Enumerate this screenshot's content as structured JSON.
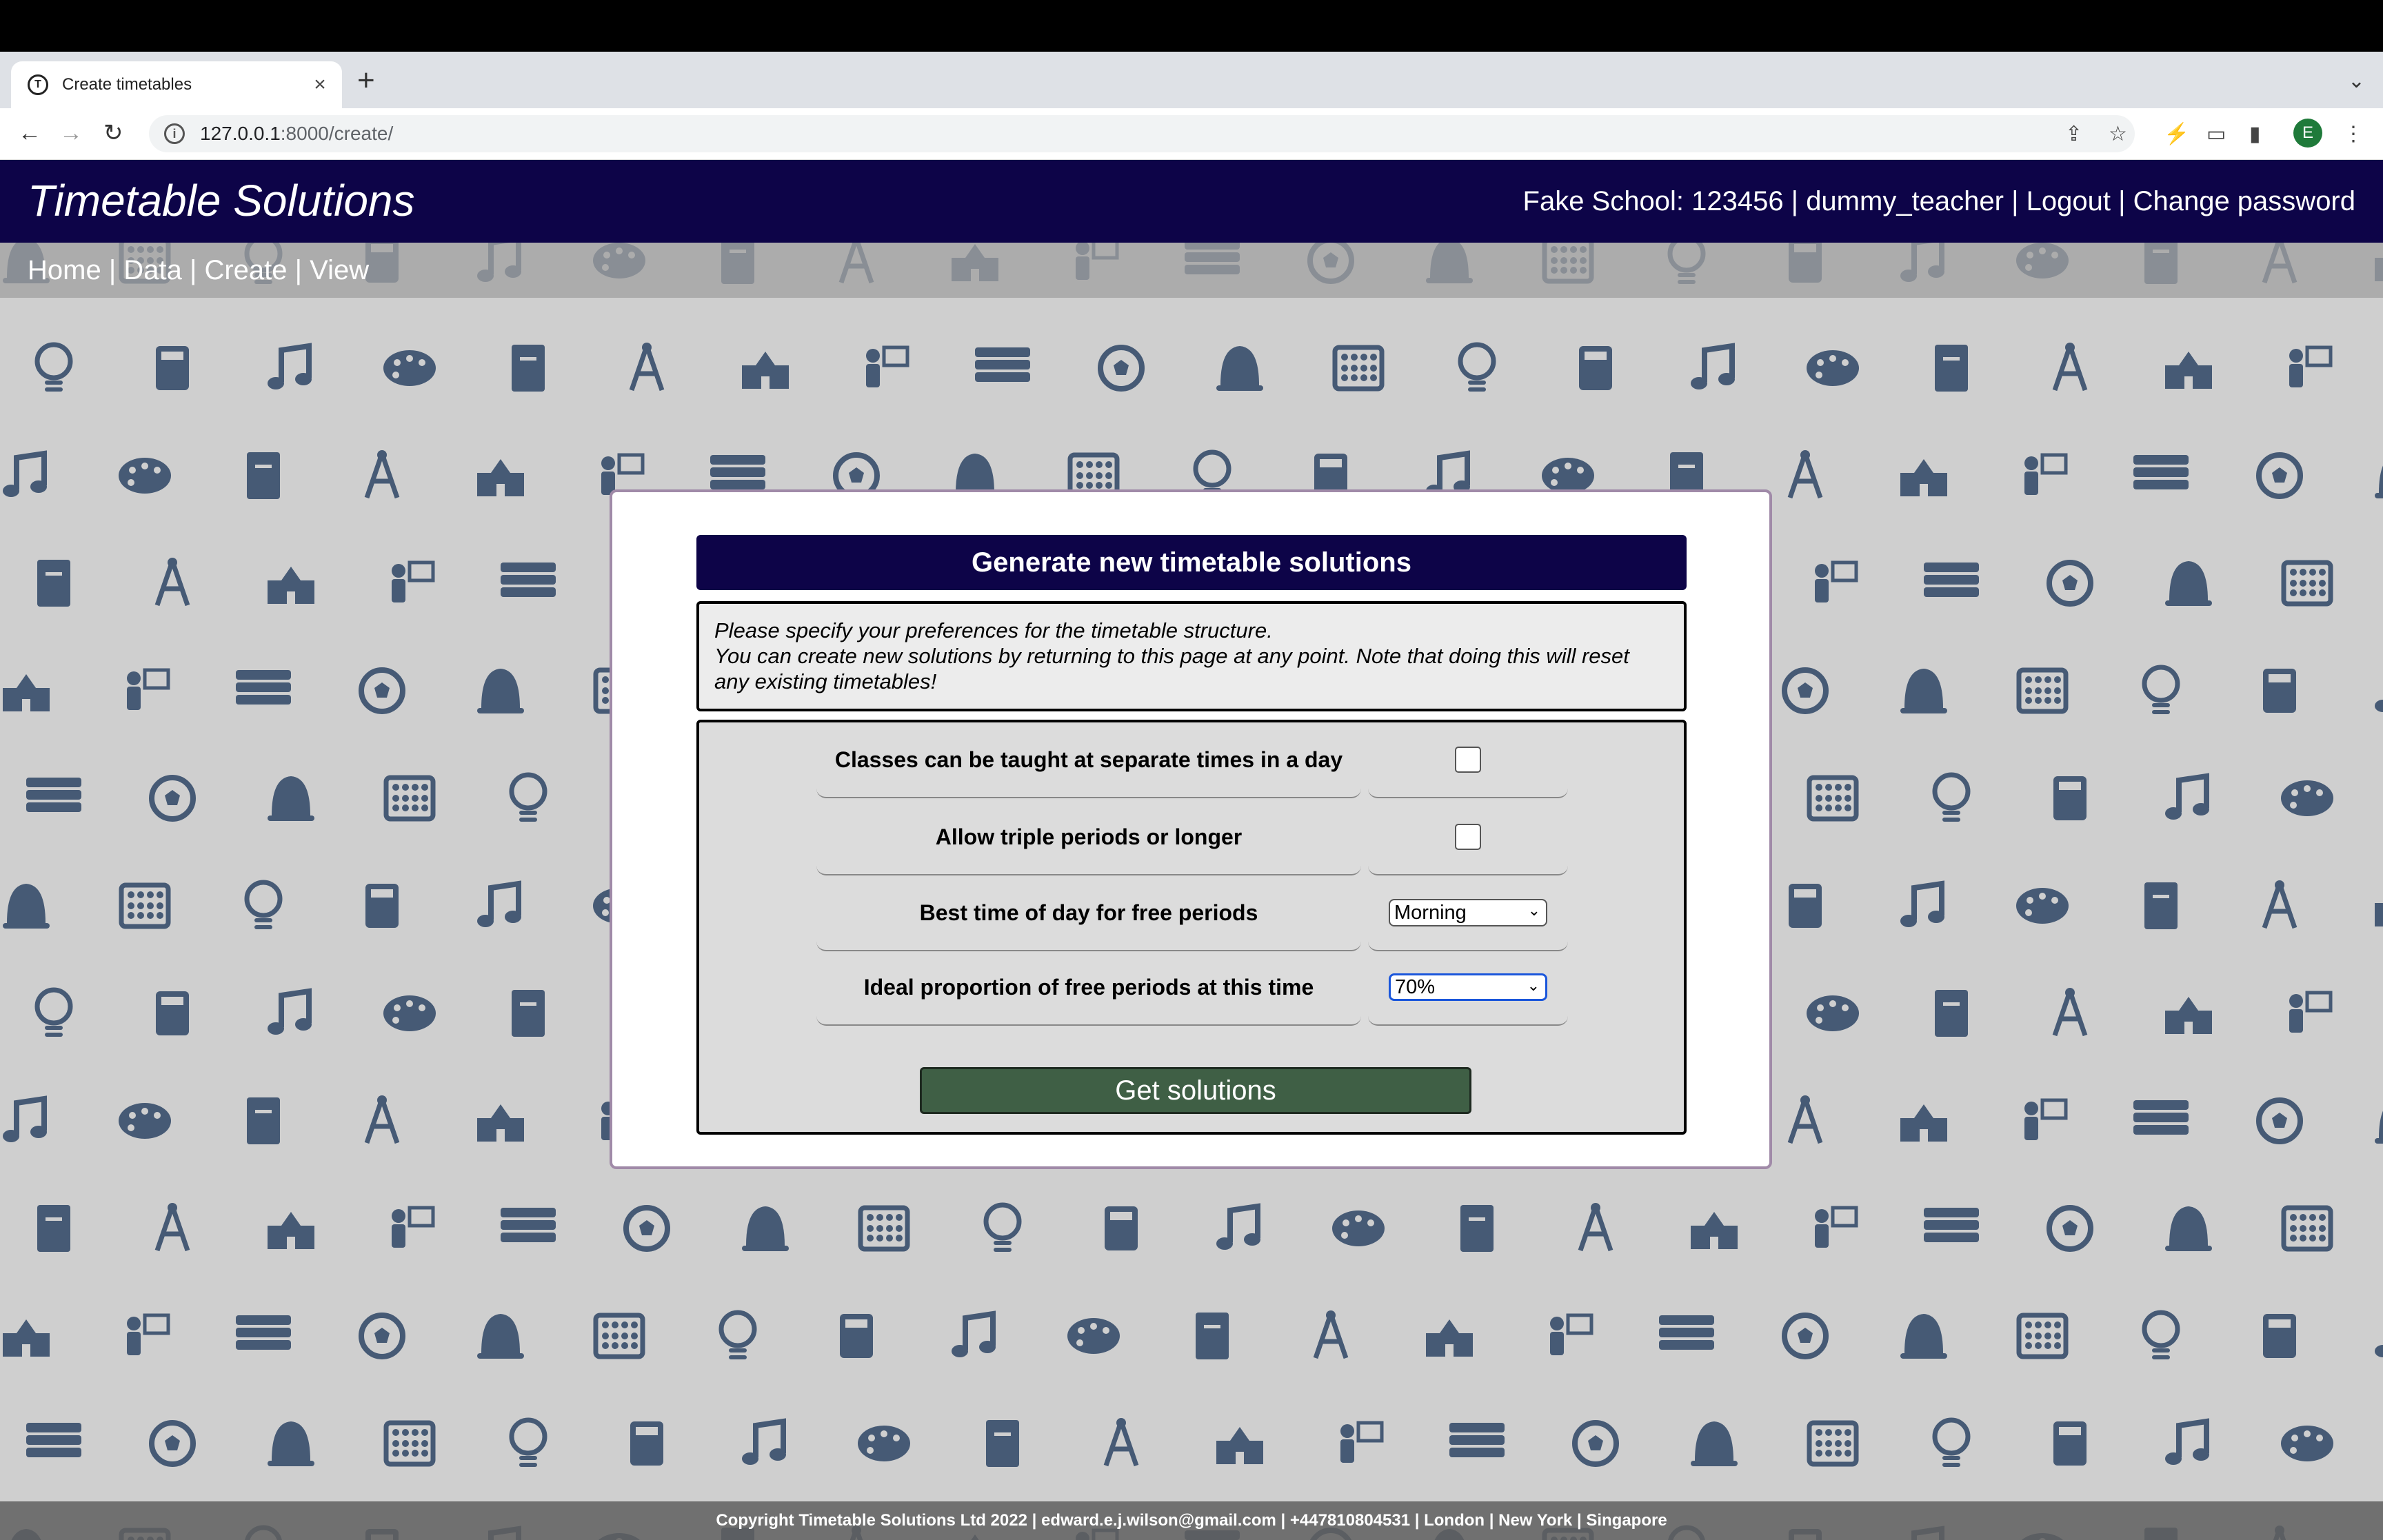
{
  "browser": {
    "tab_title": "Create timetables",
    "url_host": "127.0.0.1",
    "url_path": ":8000/create/",
    "profile_initial": "E"
  },
  "header": {
    "brand": "Timetable Solutions",
    "school": "Fake School: 123456",
    "username": "dummy_teacher",
    "logout": "Logout",
    "change_password": "Change password",
    "separator": " | "
  },
  "nav": {
    "home": "Home",
    "data": "Data",
    "create": "Create",
    "view": "View",
    "separator": " | "
  },
  "modal": {
    "title": "Generate new timetable solutions",
    "info_line1": "Please specify your preferences for the timetable structure.",
    "info_line2": "You can create new solutions by returning to this page at any point. Note that doing this will reset any existing timetables!",
    "rows": [
      {
        "label": "Classes can be taught at separate times in a day",
        "type": "checkbox",
        "checked": false
      },
      {
        "label": "Allow triple periods or longer",
        "type": "checkbox",
        "checked": false
      },
      {
        "label": "Best time of day for free periods",
        "type": "select",
        "value": "Morning"
      },
      {
        "label": "Ideal proportion of free periods at this time",
        "type": "select",
        "value": "70%"
      }
    ],
    "submit_label": "Get solutions"
  },
  "footer": {
    "text": "Copyright Timetable Solutions Ltd 2022 | edward.e.j.wilson@gmail.com | +447810804531 | London | New York | Singapore"
  },
  "colors": {
    "header_bg": "#0d0448",
    "button_bg": "#3f5f45",
    "icon_color": "#465a75",
    "page_bg": "#cfcfcf"
  }
}
